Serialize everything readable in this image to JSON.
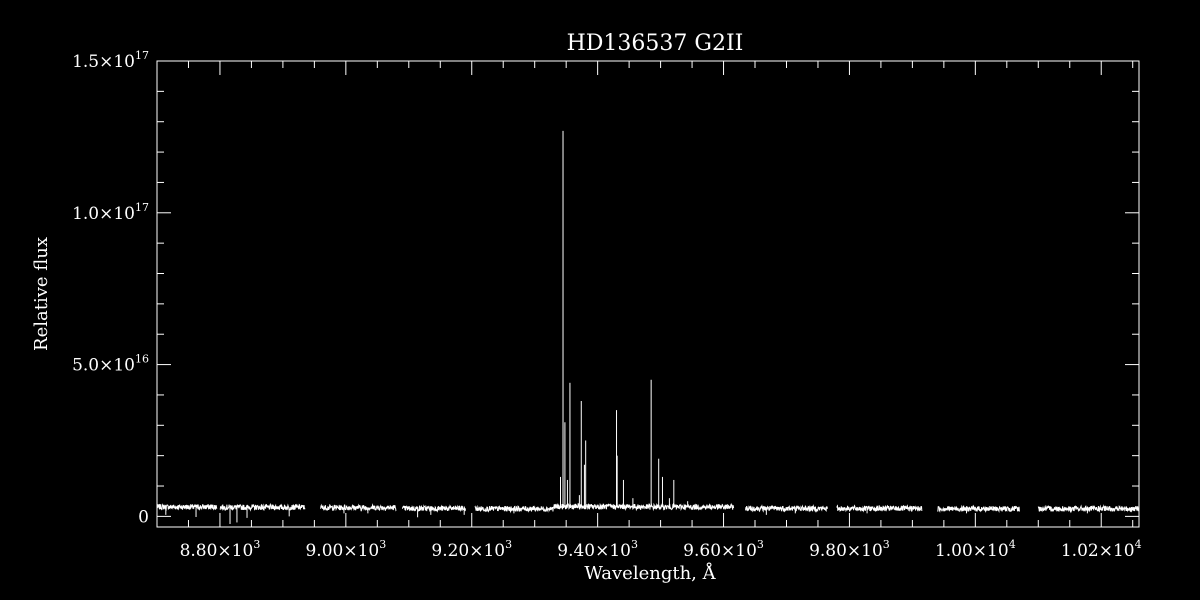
{
  "chart_data": {
    "type": "line",
    "title": "HD136537   G2II",
    "xlabel": "Wavelength, Å",
    "ylabel": "Relative flux",
    "xlim": [
      8700,
      10260
    ],
    "ylim": [
      -3500000000000000.0,
      1.5e+17
    ],
    "x_ticks": [
      {
        "value": 8800,
        "mantissa": "8.80×10",
        "exp": "3"
      },
      {
        "value": 9000,
        "mantissa": "9.00×10",
        "exp": "3"
      },
      {
        "value": 9200,
        "mantissa": "9.20×10",
        "exp": "3"
      },
      {
        "value": 9400,
        "mantissa": "9.40×10",
        "exp": "3"
      },
      {
        "value": 9600,
        "mantissa": "9.60×10",
        "exp": "3"
      },
      {
        "value": 9800,
        "mantissa": "9.80×10",
        "exp": "3"
      },
      {
        "value": 10000,
        "mantissa": "1.00×10",
        "exp": "4"
      },
      {
        "value": 10200,
        "mantissa": "1.02×10",
        "exp": "4"
      }
    ],
    "y_ticks": [
      {
        "value": 0,
        "mantissa": "0",
        "exp": ""
      },
      {
        "value": 5e+16,
        "mantissa": "5.0×10",
        "exp": "16"
      },
      {
        "value": 1e+17,
        "mantissa": "1.0×10",
        "exp": "17"
      },
      {
        "value": 1.5e+17,
        "mantissa": "1.5×10",
        "exp": "17"
      }
    ],
    "grid": false,
    "legend": "none",
    "colors": {
      "background": "#000000",
      "foreground": "#ffffff"
    },
    "continuum_level": 3000000000000000.0,
    "segments": [
      {
        "x_start": 8700,
        "x_end": 8795,
        "level": 3100000000000000.0
      },
      {
        "x_start": 8800,
        "x_end": 8935,
        "level": 3000000000000000.0
      },
      {
        "x_start": 8960,
        "x_end": 9080,
        "level": 2900000000000000.0
      },
      {
        "x_start": 9090,
        "x_end": 9190,
        "level": 2600000000000000.0
      },
      {
        "x_start": 9205,
        "x_end": 9330,
        "level": 2500000000000000.0
      },
      {
        "x_start": 9330,
        "x_end": 9460,
        "level": 3200000000000000.0
      },
      {
        "x_start": 9460,
        "x_end": 9616,
        "level": 3100000000000000.0
      },
      {
        "x_start": 9635,
        "x_end": 9765,
        "level": 2600000000000000.0
      },
      {
        "x_start": 9780,
        "x_end": 9915,
        "level": 2600000000000000.0
      },
      {
        "x_start": 9940,
        "x_end": 10070,
        "level": 2500000000000000.0
      },
      {
        "x_start": 10100,
        "x_end": 10260,
        "level": 2500000000000000.0
      }
    ],
    "emission_spikes": [
      {
        "x": 9341,
        "y": 1.3e+16
      },
      {
        "x": 9345,
        "y": 1.27e+17
      },
      {
        "x": 9348,
        "y": 3.1e+16
      },
      {
        "x": 9352,
        "y": 1.2e+16
      },
      {
        "x": 9356,
        "y": 4.4e+16
      },
      {
        "x": 9371,
        "y": 7000000000000000.0
      },
      {
        "x": 9374,
        "y": 3.8e+16
      },
      {
        "x": 9379,
        "y": 1.7e+16
      },
      {
        "x": 9381,
        "y": 2.5e+16
      },
      {
        "x": 9430,
        "y": 3.5e+16
      },
      {
        "x": 9431,
        "y": 2e+16
      },
      {
        "x": 9441,
        "y": 1.2e+16
      },
      {
        "x": 9456,
        "y": 6000000000000000.0
      },
      {
        "x": 9485,
        "y": 4.5e+16
      },
      {
        "x": 9497,
        "y": 1.9e+16
      },
      {
        "x": 9503,
        "y": 1.3e+16
      },
      {
        "x": 9514,
        "y": 6000000000000000.0
      },
      {
        "x": 9521,
        "y": 1.2e+16
      },
      {
        "x": 9543,
        "y": 5000000000000000.0
      }
    ],
    "absorption_dips": [
      {
        "x": 8714,
        "y": 500000000000000.0
      },
      {
        "x": 8762,
        "y": -200000000000000.0
      },
      {
        "x": 8816,
        "y": -2500000000000000.0
      },
      {
        "x": 8827,
        "y": -2000000000000000.0
      },
      {
        "x": 8843,
        "y": -500000000000000.0
      },
      {
        "x": 8910,
        "y": 0
      },
      {
        "x": 8997,
        "y": 1000000000000000.0
      },
      {
        "x": 9035,
        "y": 1000000000000000.0
      },
      {
        "x": 9114,
        "y": -300000000000000.0
      },
      {
        "x": 9135,
        "y": 500000000000000.0
      },
      {
        "x": 9188,
        "y": 500000000000000.0
      },
      {
        "x": 9267,
        "y": 1000000000000000.0
      },
      {
        "x": 9668,
        "y": 500000000000000.0
      },
      {
        "x": 9714,
        "y": 1000000000000000.0
      },
      {
        "x": 9828,
        "y": 1000000000000000.0
      },
      {
        "x": 9986,
        "y": 1000000000000000.0
      },
      {
        "x": 10178,
        "y": 1000000000000000.0
      }
    ]
  }
}
